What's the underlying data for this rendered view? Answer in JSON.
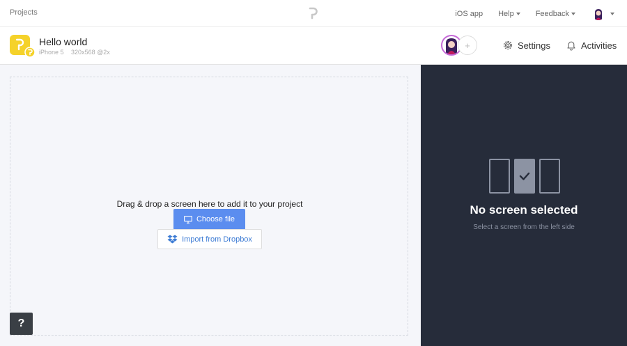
{
  "topnav": {
    "projects_label": "Projects",
    "ios_app_label": "iOS app",
    "help_label": "Help",
    "feedback_label": "Feedback"
  },
  "project": {
    "title": "Hello world",
    "device": "iPhone 5",
    "resolution": "320x568 @2x"
  },
  "header": {
    "add_collaborator": "+",
    "settings_label": "Settings",
    "activities_label": "Activities"
  },
  "dropzone": {
    "instruction": "Drag & drop a screen here to add it to your project",
    "choose_file_label": "Choose file",
    "dropbox_label": "Import from Dropbox"
  },
  "help": {
    "label": "?"
  },
  "sidepanel": {
    "title": "No screen selected",
    "subtitle": "Select a screen from the left side"
  },
  "colors": {
    "accent": "#5b8def",
    "dark_panel": "#262c3a",
    "brand_yellow": "#f5d22a",
    "dropbox_blue": "#3c7bd4"
  },
  "icons": {
    "logo": "prott-logo-icon",
    "app": "app-icon",
    "settings": "gear-icon",
    "activities": "bell-icon",
    "choose_file": "monitor-icon",
    "dropbox": "dropbox-icon",
    "screens": "screens-icon"
  }
}
